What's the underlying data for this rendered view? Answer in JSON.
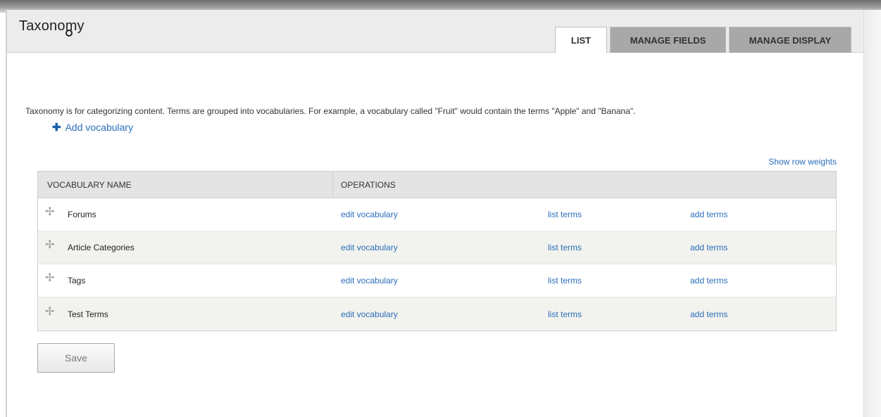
{
  "header": {
    "title": "Taxonomy",
    "tabs": [
      {
        "label": "LIST",
        "active": true
      },
      {
        "label": "MANAGE FIELDS",
        "active": false
      },
      {
        "label": "MANAGE DISPLAY",
        "active": false
      }
    ]
  },
  "main": {
    "description": "Taxonomy is for categorizing content. Terms are grouped into vocabularies. For example, a vocabulary called \"Fruit\" would contain the terms \"Apple\" and \"Banana\".",
    "add_vocabulary": "Add vocabulary",
    "show_row_weights": "Show row weights",
    "save_label": "Save"
  },
  "table": {
    "columns": [
      "VOCABULARY NAME",
      "OPERATIONS"
    ],
    "rows": [
      {
        "name": "Forums",
        "edit": "edit vocabulary",
        "list": "list terms",
        "add": "add terms"
      },
      {
        "name": "Article Categories",
        "edit": "edit vocabulary",
        "list": "list terms",
        "add": "add terms"
      },
      {
        "name": "Tags",
        "edit": "edit vocabulary",
        "list": "list terms",
        "add": "add terms"
      },
      {
        "name": "Test Terms",
        "edit": "edit vocabulary",
        "list": "list terms",
        "add": "add terms"
      }
    ]
  },
  "icons": {
    "gear": "gear-icon",
    "add": "plus-icon",
    "drag": "drag-handle-icon"
  },
  "colors": {
    "link": "#2a6ebb",
    "header_bg": "#ececec",
    "tab_inactive": "#a8a8a8",
    "table_header_bg": "#e4e4e4"
  }
}
